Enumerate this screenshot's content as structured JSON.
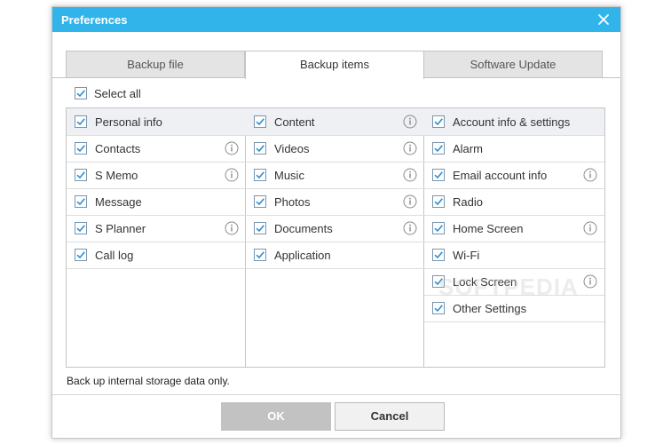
{
  "dialog": {
    "title": "Preferences",
    "tabs": [
      {
        "label": "Backup file",
        "active": false
      },
      {
        "label": "Backup items",
        "active": true
      },
      {
        "label": "Software Update",
        "active": false
      }
    ],
    "select_all_label": "Select all",
    "columns": [
      {
        "items": [
          {
            "label": "Personal info",
            "checked": true,
            "header": true,
            "info": false
          },
          {
            "label": "Contacts",
            "checked": true,
            "info": true
          },
          {
            "label": "S Memo",
            "checked": true,
            "info": true
          },
          {
            "label": "Message",
            "checked": true,
            "info": false
          },
          {
            "label": "S Planner",
            "checked": true,
            "info": true
          },
          {
            "label": "Call log",
            "checked": true,
            "info": false
          }
        ]
      },
      {
        "items": [
          {
            "label": "Content",
            "checked": true,
            "header": true,
            "info": true
          },
          {
            "label": "Videos",
            "checked": true,
            "info": true
          },
          {
            "label": "Music",
            "checked": true,
            "info": true
          },
          {
            "label": "Photos",
            "checked": true,
            "info": true
          },
          {
            "label": "Documents",
            "checked": true,
            "info": true
          },
          {
            "label": "Application",
            "checked": true,
            "info": false
          }
        ]
      },
      {
        "items": [
          {
            "label": "Account info & settings",
            "checked": true,
            "header": true,
            "info": false
          },
          {
            "label": "Alarm",
            "checked": true,
            "info": false
          },
          {
            "label": "Email account info",
            "checked": true,
            "info": true
          },
          {
            "label": "Radio",
            "checked": true,
            "info": false
          },
          {
            "label": "Home Screen",
            "checked": true,
            "info": true
          },
          {
            "label": "Wi-Fi",
            "checked": true,
            "info": false
          },
          {
            "label": "Lock Screen",
            "checked": true,
            "info": true
          },
          {
            "label": "Other Settings",
            "checked": true,
            "info": false
          }
        ]
      }
    ],
    "footnote": "Back up internal storage data only.",
    "ok_label": "OK",
    "cancel_label": "Cancel",
    "watermark": "SOFTPEDIA"
  },
  "colors": {
    "titlebar": "#31b4ea",
    "check": "#2a8fd6",
    "header_row": "#eef0f4",
    "ok_disabled": "#c2c2c2"
  }
}
